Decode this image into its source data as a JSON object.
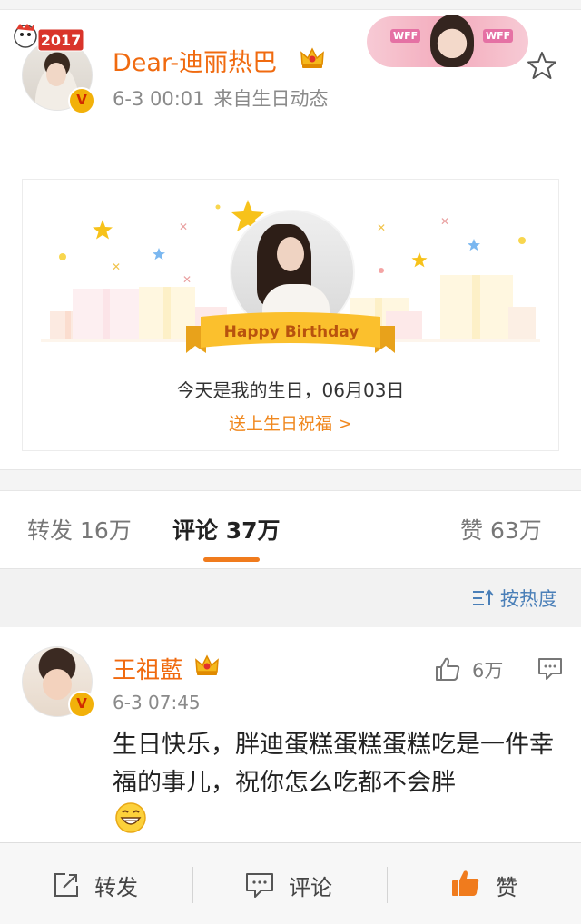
{
  "post": {
    "username": "Dear-迪丽热巴",
    "time": "6-3 00:01",
    "source": "来自生日动态",
    "year_badge": "2017",
    "verified_mark": "V",
    "fan_badge_text": "WFF"
  },
  "birthday_card": {
    "ribbon": "Happy Birthday",
    "message": "今天是我的生日，06月03日",
    "link": "送上生日祝福 >"
  },
  "tabs": {
    "repost": "转发 16万",
    "comment": "评论 37万",
    "like": "赞 63万"
  },
  "sort": {
    "label": "按热度"
  },
  "comment": {
    "username": "王祖藍",
    "verified_mark": "V",
    "time": "6-3 07:45",
    "likes": "6万",
    "text": "生日快乐，胖迪蛋糕蛋糕蛋糕吃是一件幸福的事儿，祝你怎么吃都不会胖"
  },
  "bottom_bar": {
    "repost": "转发",
    "comment": "评论",
    "like": "赞"
  },
  "colors": {
    "accent_orange": "#f06a0f",
    "link_blue": "#4a7fb8",
    "verified_gold": "#f2b10a"
  },
  "icons": [
    "star-outline-icon",
    "crown-vip-icon",
    "thumb-up-icon",
    "comment-bubble-icon",
    "repost-icon",
    "sort-icon",
    "grin-emoji-icon"
  ]
}
